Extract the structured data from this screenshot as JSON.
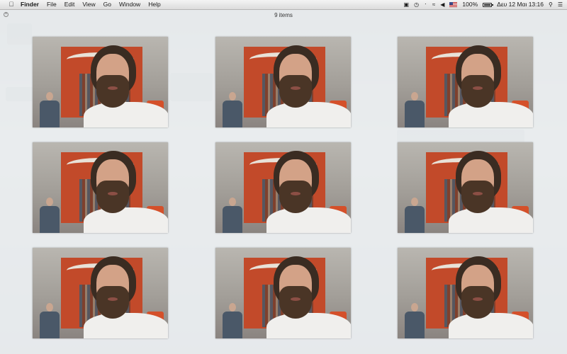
{
  "menubar": {
    "apple_icon": "apple-icon",
    "app_name": "Finder",
    "menus": [
      "File",
      "Edit",
      "View",
      "Go",
      "Window",
      "Help"
    ],
    "status": {
      "battery_percent": "100%",
      "battery_level": 1.0,
      "datetime": "Δευ 12 Μαι  13:16",
      "icons": [
        "display-icon",
        "time-machine-icon",
        "bluetooth-icon",
        "wifi-icon",
        "volume-icon",
        "us-flag-icon",
        "battery-icon",
        "search-icon",
        "list-icon"
      ]
    }
  },
  "quicklook": {
    "item_count": "9 items",
    "close_icon": "close-icon",
    "thumbnails": [
      {
        "label": "portrait-photo"
      },
      {
        "label": "portrait-photo"
      },
      {
        "label": "portrait-photo"
      },
      {
        "label": "portrait-photo"
      },
      {
        "label": "portrait-photo"
      },
      {
        "label": "portrait-photo"
      },
      {
        "label": "portrait-photo"
      },
      {
        "label": "portrait-photo"
      },
      {
        "label": "portrait-photo"
      }
    ]
  }
}
